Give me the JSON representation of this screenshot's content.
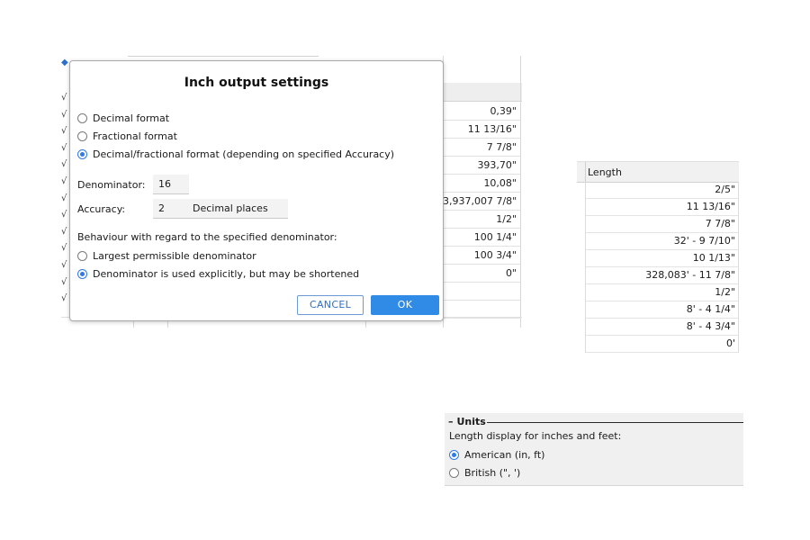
{
  "background_sheet": {
    "values": [
      "0,39\"",
      "11 13/16\"",
      "7 7/8\"",
      "393,70\"",
      "10,08\"",
      "3,937,007 7/8\"",
      "1/2\"",
      "100 1/4\"",
      "100 3/4\"",
      "0\""
    ]
  },
  "dialog": {
    "title": "Inch output settings",
    "format_options": [
      {
        "label": "Decimal format",
        "selected": false
      },
      {
        "label": "Fractional format",
        "selected": false
      },
      {
        "label": "Decimal/fractional format (depending on specified Accuracy)",
        "selected": true
      }
    ],
    "denominator_label": "Denominator:",
    "denominator_value": "16",
    "accuracy_label": "Accuracy:",
    "accuracy_value": "2",
    "accuracy_unit": "Decimal places",
    "behaviour_label": "Behaviour with regard to the specified denominator:",
    "behaviour_options": [
      {
        "label": "Largest permissible denominator",
        "selected": false
      },
      {
        "label": "Denominator is used explicitly, but may be shortened",
        "selected": true
      }
    ],
    "cancel_label": "CANCEL",
    "ok_label": "OK"
  },
  "length_table": {
    "header": "Length",
    "values": [
      "2/5\"",
      "11 13/16\"",
      "7 7/8\"",
      "32' - 9 7/10\"",
      "10 1/13\"",
      "328,083' - 11 7/8\"",
      "1/2\"",
      "8' - 4 1/4\"",
      "8' - 4 3/4\"",
      "0'"
    ]
  },
  "units_panel": {
    "title": "Units",
    "description": "Length display for inches and feet:",
    "options": [
      {
        "label": "American (in, ft)",
        "selected": true
      },
      {
        "label": "British (\", ')",
        "selected": false
      }
    ]
  },
  "colors": {
    "accent": "#2f8be6",
    "radio_selected": "#2f7ae5",
    "panel_bg": "#f0f0f0"
  }
}
